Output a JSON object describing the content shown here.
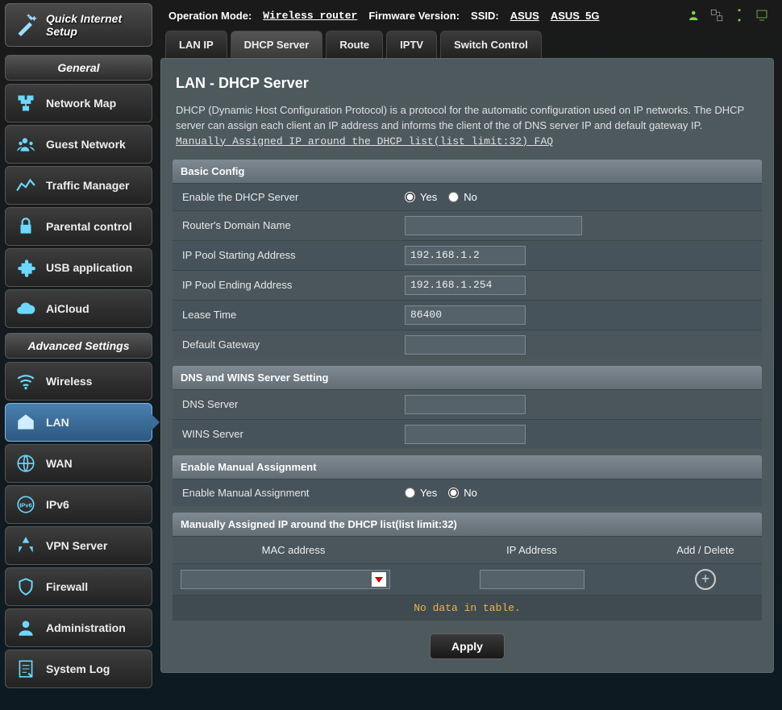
{
  "quick_setup": "Quick Internet Setup",
  "topbar": {
    "op_mode_label": "Operation Mode:",
    "op_mode_value": "Wireless router",
    "fw_label": "Firmware Version:",
    "ssid_label": "SSID:",
    "ssid_value_1": "ASUS",
    "ssid_value_2": "ASUS_5G"
  },
  "sidebar": {
    "general_header": "General",
    "advanced_header": "Advanced Settings",
    "general": [
      {
        "label": "Network Map"
      },
      {
        "label": "Guest Network"
      },
      {
        "label": "Traffic Manager"
      },
      {
        "label": "Parental control"
      },
      {
        "label": "USB application"
      },
      {
        "label": "AiCloud"
      }
    ],
    "advanced": [
      {
        "label": "Wireless"
      },
      {
        "label": "LAN"
      },
      {
        "label": "WAN"
      },
      {
        "label": "IPv6"
      },
      {
        "label": "VPN Server"
      },
      {
        "label": "Firewall"
      },
      {
        "label": "Administration"
      },
      {
        "label": "System Log"
      }
    ]
  },
  "tabs": [
    {
      "label": "LAN IP"
    },
    {
      "label": "DHCP Server"
    },
    {
      "label": "Route"
    },
    {
      "label": "IPTV"
    },
    {
      "label": "Switch Control"
    }
  ],
  "page_title": "LAN - DHCP Server",
  "description": "DHCP (Dynamic Host Configuration Protocol) is a protocol for the automatic configuration used on IP networks. The DHCP server can assign each client an IP address and informs the client of the of DNS server IP and default gateway IP.",
  "faq_link": "Manually Assigned IP around the DHCP list(list limit:32) FAQ",
  "sections": {
    "basic": {
      "title": "Basic Config",
      "enable_label": "Enable the DHCP Server",
      "yes": "Yes",
      "no": "No",
      "domain_label": "Router's Domain Name",
      "domain_value": "",
      "pool_start_label": "IP Pool Starting Address",
      "pool_start_value": "192.168.1.2",
      "pool_end_label": "IP Pool Ending Address",
      "pool_end_value": "192.168.1.254",
      "lease_label": "Lease Time",
      "lease_value": "86400",
      "gateway_label": "Default Gateway",
      "gateway_value": ""
    },
    "dns": {
      "title": "DNS and WINS Server Setting",
      "dns_label": "DNS Server",
      "dns_value": "",
      "wins_label": "WINS Server",
      "wins_value": ""
    },
    "manual": {
      "title": "Enable Manual Assignment",
      "label": "Enable Manual Assignment",
      "yes": "Yes",
      "no": "No"
    },
    "table": {
      "title": "Manually Assigned IP around the DHCP list(list limit:32)",
      "col_mac": "MAC address",
      "col_ip": "IP Address",
      "col_action": "Add / Delete",
      "nodata": "No data in table."
    }
  },
  "apply": "Apply"
}
